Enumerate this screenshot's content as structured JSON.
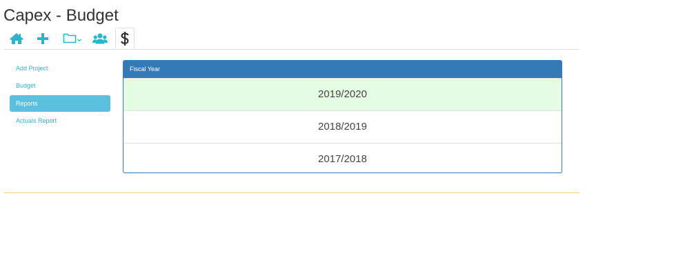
{
  "page": {
    "title": "Capex - Budget"
  },
  "tabs": [
    {
      "icon": "home-icon",
      "active": false
    },
    {
      "icon": "plus-icon",
      "active": false
    },
    {
      "icon": "folder-icon",
      "active": false
    },
    {
      "icon": "users-icon",
      "active": false
    },
    {
      "icon": "dollar-icon",
      "active": true
    }
  ],
  "sidebar": {
    "items": [
      {
        "label": "Add Project",
        "active": false
      },
      {
        "label": "Budget",
        "active": false
      },
      {
        "label": "Reports",
        "active": true
      },
      {
        "label": "Actuals Report",
        "active": false
      }
    ]
  },
  "panel": {
    "heading": "Fiscal Year",
    "years": [
      {
        "label": "2019/2020",
        "highlighted": true
      },
      {
        "label": "2018/2019",
        "highlighted": false
      },
      {
        "label": "2017/2018",
        "highlighted": false
      }
    ]
  },
  "colors": {
    "accent": "#29b6c9",
    "panel_header": "#337ab7",
    "sidebar_active": "#5bc0de",
    "highlight_row": "#e4fce4",
    "footer_rule": "#f5d47a"
  }
}
